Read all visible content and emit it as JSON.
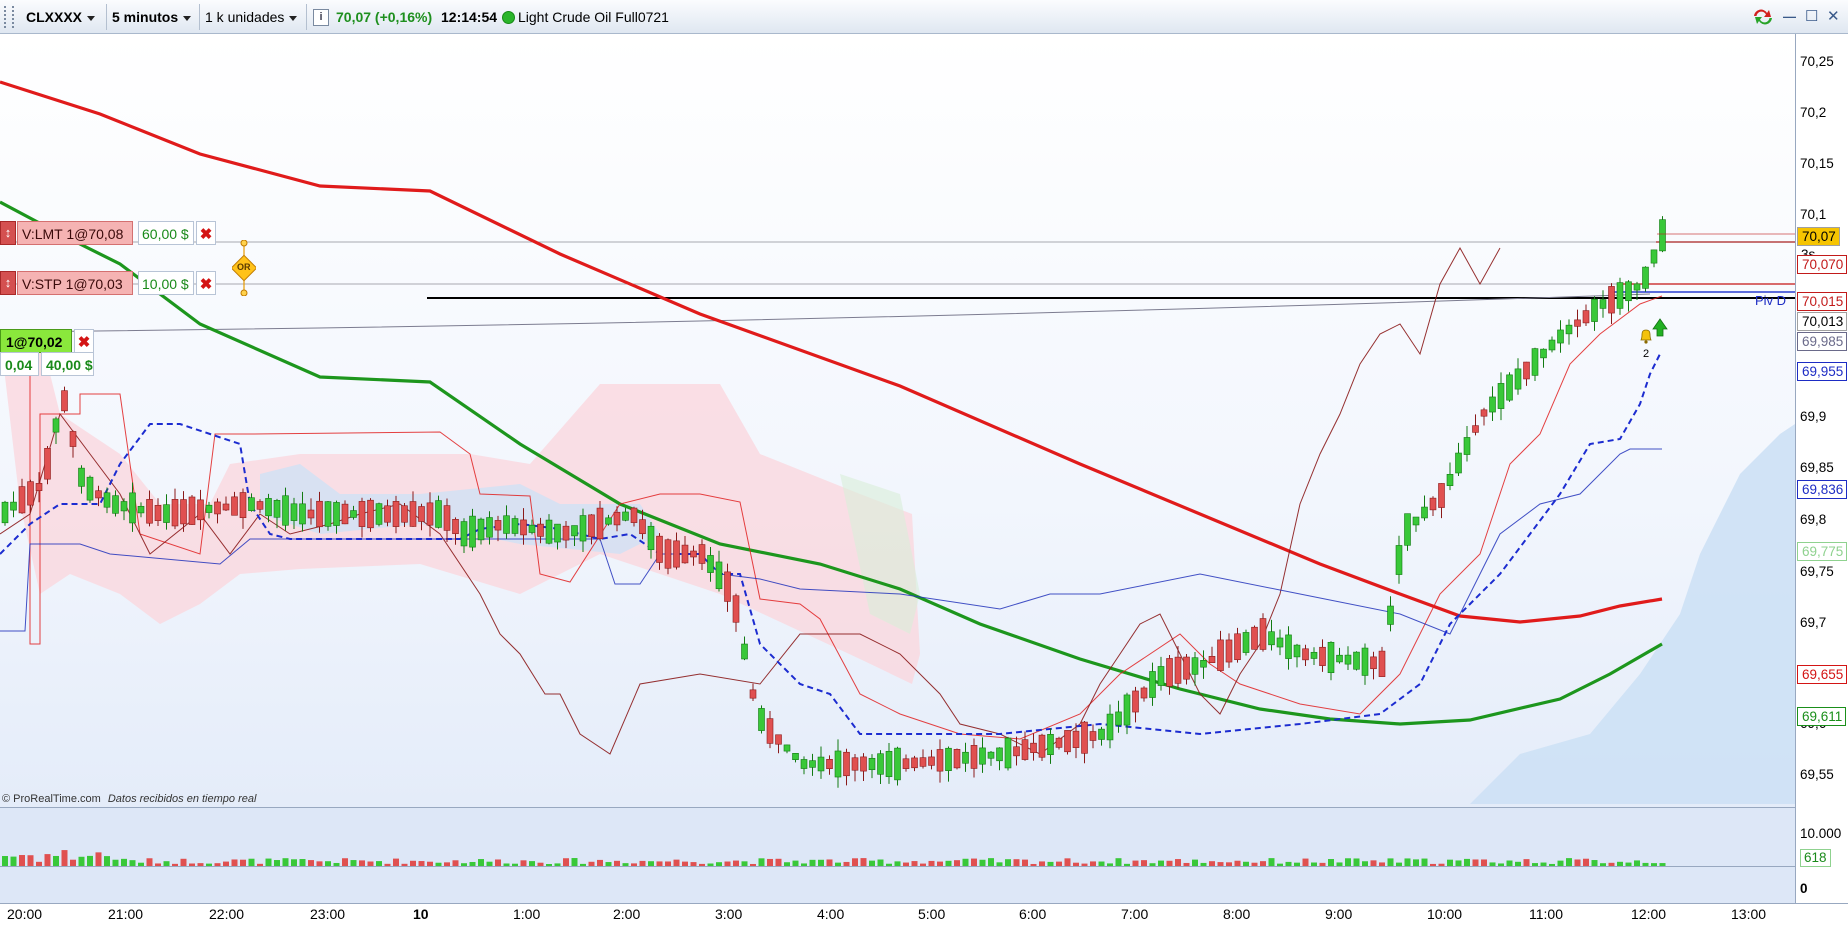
{
  "toolbar": {
    "symbol": "CLXXXX",
    "timeframe": "5 minutos",
    "units": "1 k unidades",
    "info_icon": "i",
    "price": "70,07 (+0,16%)",
    "clock": "12:14:54",
    "instrument": "Light Crude Oil Full0721",
    "colors": {
      "up": "#1e8f1e",
      "status": "#2ab52a"
    }
  },
  "orders": {
    "limit": {
      "label": "V:LMT 1@70,08",
      "pnl": "60,00 $"
    },
    "stop": {
      "label": "V:STP 1@70,03",
      "pnl": "10,00 $"
    },
    "oco_badge": "OR",
    "position": {
      "label": "1@70,02",
      "diff": "0,04",
      "pnl": "40,00 $"
    }
  },
  "price_axis": {
    "ticks": [
      "70,25",
      "70,2",
      "70,15",
      "70,1",
      "70,05",
      "69,9",
      "69,85",
      "69,8",
      "69,75",
      "69,7",
      "69,6",
      "69,55"
    ],
    "tags": [
      {
        "text": "70,07",
        "color": "#000000",
        "bg": "#f6c400"
      },
      {
        "text": "3s",
        "color": "#000000",
        "bg": "#ffffff"
      },
      {
        "text": "70,070",
        "color": "#c21a1a",
        "bg": "#ffffff"
      },
      {
        "text": "70,015",
        "color": "#c21a1a",
        "bg": "#ffffff"
      },
      {
        "text": "70,013",
        "color": "#000000",
        "bg": "#ffffff"
      },
      {
        "text": "69,985",
        "color": "#6a6a8a",
        "bg": "#ffffff"
      },
      {
        "text": "69,955",
        "color": "#1d2cc4",
        "bg": "#ffffff"
      },
      {
        "text": "69,836",
        "color": "#1d2cc4",
        "bg": "#ffffff"
      },
      {
        "text": "69,775",
        "color": "#8fd28f",
        "bg": "#ffffff"
      },
      {
        "text": "69,655",
        "color": "#d31414",
        "bg": "#ffffff"
      },
      {
        "text": "69,611",
        "color": "#1a8f1a",
        "bg": "#ffffff"
      }
    ],
    "pivot_label": "Piv D",
    "alert_count": "2"
  },
  "volume_axis": {
    "top": "10.000",
    "value": "618",
    "zero": "0"
  },
  "time_axis": [
    "20:00",
    "21:00",
    "22:00",
    "23:00",
    "10",
    "1:00",
    "2:00",
    "3:00",
    "4:00",
    "5:00",
    "6:00",
    "7:00",
    "8:00",
    "9:00",
    "10:00",
    "11:00",
    "12:00",
    "13:00"
  ],
  "footer": {
    "brand": "© ProRealTime.com",
    "status": "Datos recibidos en tiempo real"
  },
  "window_controls": {
    "minimize": "—",
    "maximize": "☐",
    "close": "✕"
  }
}
